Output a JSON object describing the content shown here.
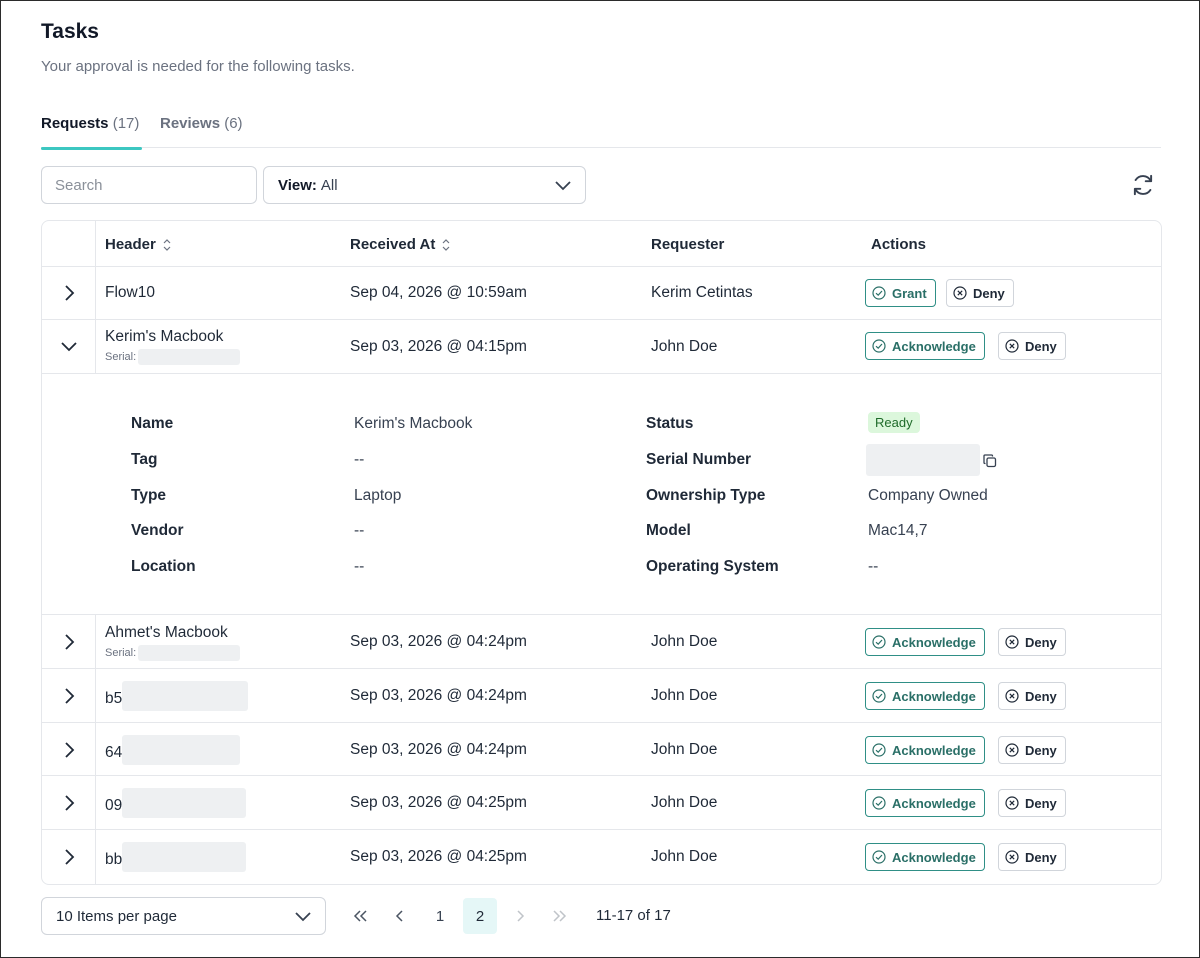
{
  "page": {
    "title": "Tasks",
    "subtitle": "Your approval is needed for the following tasks."
  },
  "tabs": [
    {
      "label": "Requests",
      "count": "(17)",
      "active": true
    },
    {
      "label": "Reviews",
      "count": "(6)",
      "active": false
    }
  ],
  "toolbar": {
    "search_placeholder": "Search",
    "view_label": "View:",
    "view_value": "All"
  },
  "table": {
    "columns": {
      "header": "Header",
      "received_at": "Received At",
      "requester": "Requester",
      "actions": "Actions"
    },
    "rows": [
      {
        "header": "Flow10",
        "received_at": "Sep 04, 2026 @ 10:59am",
        "requester": "Kerim Cetintas",
        "primary_action": "Grant",
        "deny": "Deny",
        "expanded": false
      },
      {
        "header": "Kerim's Macbook",
        "serial_label": "Serial:",
        "received_at": "Sep 03, 2026 @ 04:15pm",
        "requester": "John Doe",
        "primary_action": "Acknowledge",
        "deny": "Deny",
        "expanded": true
      },
      {
        "header": "Ahmet's Macbook",
        "serial_label": "Serial:",
        "received_at": "Sep 03, 2026 @ 04:24pm",
        "requester": "John Doe",
        "primary_action": "Acknowledge",
        "deny": "Deny",
        "expanded": false
      },
      {
        "header": "b5",
        "received_at": "Sep 03, 2026 @ 04:24pm",
        "requester": "John Doe",
        "primary_action": "Acknowledge",
        "deny": "Deny",
        "expanded": false
      },
      {
        "header": "64",
        "received_at": "Sep 03, 2026 @ 04:24pm",
        "requester": "John Doe",
        "primary_action": "Acknowledge",
        "deny": "Deny",
        "expanded": false
      },
      {
        "header": "09",
        "received_at": "Sep 03, 2026 @ 04:25pm",
        "requester": "John Doe",
        "primary_action": "Acknowledge",
        "deny": "Deny",
        "expanded": false
      },
      {
        "header": "bb",
        "received_at": "Sep 03, 2026 @ 04:25pm",
        "requester": "John Doe",
        "primary_action": "Acknowledge",
        "deny": "Deny",
        "expanded": false
      }
    ],
    "details": {
      "name_label": "Name",
      "name_value": "Kerim's Macbook",
      "tag_label": "Tag",
      "tag_value": "--",
      "type_label": "Type",
      "type_value": "Laptop",
      "vendor_label": "Vendor",
      "vendor_value": "--",
      "location_label": "Location",
      "location_value": "--",
      "status_label": "Status",
      "status_value": "Ready",
      "serial_label": "Serial Number",
      "ownership_label": "Ownership Type",
      "ownership_value": "Company Owned",
      "model_label": "Model",
      "model_value": "Mac14,7",
      "os_label": "Operating System",
      "os_value": "--"
    }
  },
  "pagination": {
    "per_page": "10 Items per page",
    "pages": [
      "1",
      "2"
    ],
    "current_page": "2",
    "info": "11-17 of 17"
  },
  "colors": {
    "accent": "#3cc7c1",
    "action_border": "#2f8f86",
    "badge_bg": "#dcf7dc"
  }
}
